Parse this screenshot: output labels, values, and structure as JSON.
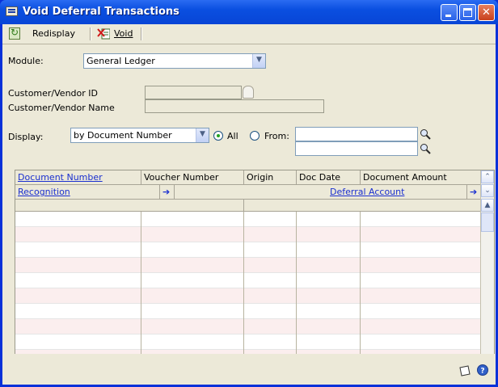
{
  "window": {
    "title": "Void Deferral Transactions"
  },
  "toolbar": {
    "redisplay_label": "Redisplay",
    "void_label": "Void"
  },
  "form": {
    "module_label": "Module:",
    "module_value": "General Ledger",
    "customer_vendor_id_label": "Customer/Vendor ID",
    "customer_vendor_id_value": "",
    "customer_vendor_name_label": "Customer/Vendor Name",
    "customer_vendor_name_value": "",
    "display_label": "Display:",
    "display_value": "by Document Number",
    "radio_all_label": "All",
    "radio_from_label": "From:",
    "selected_range": "All",
    "from_value": "",
    "to_value": ""
  },
  "grid": {
    "row1_headers": [
      "Document Number",
      "Voucher Number",
      "Origin",
      "Doc Date",
      "Document Amount"
    ],
    "row2_headers": {
      "recognition": "Recognition",
      "deferral_account": "Deferral Account"
    },
    "visible_rows": 9
  },
  "colors": {
    "title_bar": "#0a4fe0",
    "window_frame": "#0831d9",
    "form_bg": "#ece9d8",
    "link": "#1a2fd0",
    "row_alt": "#fbeeee"
  }
}
